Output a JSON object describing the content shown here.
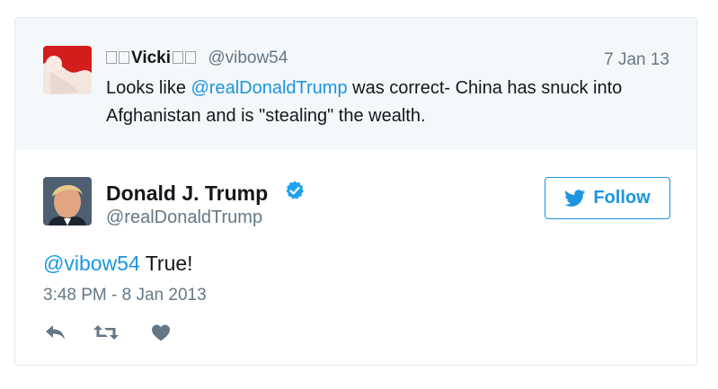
{
  "parent_tweet": {
    "name": "Vicki",
    "handle": "@vibow54",
    "date": "7 Jan 13",
    "text_before": "Looks like ",
    "mention": "@realDonaldTrump",
    "text_after": " was correct- China has snuck into Afghanistan and is \"stealing\" the wealth."
  },
  "tweet": {
    "name": "Donald J. Trump",
    "handle": "@realDonaldTrump",
    "follow_label": "Follow",
    "reply_to": "@vibow54",
    "text": " True!",
    "timestamp": "3:48 PM - 8 Jan 2013"
  },
  "icons": {
    "verified": "verified-badge-icon",
    "follow": "twitter-bird-icon",
    "reply": "reply-icon",
    "retweet": "retweet-icon",
    "like": "heart-icon"
  },
  "colors": {
    "accent": "#1b95e0",
    "muted": "#657786",
    "text": "#14171a",
    "parent_bg": "#f5f8fa",
    "border": "#e1e8ed"
  }
}
